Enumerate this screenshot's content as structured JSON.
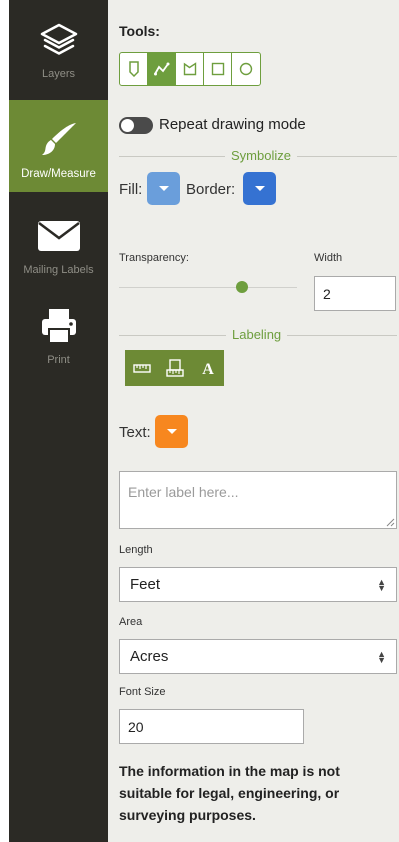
{
  "sidebar": {
    "items": [
      {
        "label": "Layers",
        "icon": "layers-icon"
      },
      {
        "label": "Draw/Measure",
        "icon": "paintbrush-icon",
        "active": true
      },
      {
        "label": "Mailing Labels",
        "icon": "envelope-icon"
      },
      {
        "label": "Print",
        "icon": "printer-icon"
      }
    ],
    "background_color": "#2b2a25",
    "active_color": "#6d8a35"
  },
  "tools": {
    "label": "Tools:",
    "buttons": [
      "marker-icon",
      "polyline-icon",
      "polygon-icon",
      "rectangle-icon",
      "circle-icon"
    ],
    "active_index": 1,
    "accent_color": "#6e9e3e"
  },
  "repeat_mode": {
    "label": "Repeat drawing mode",
    "enabled": false
  },
  "symbolize": {
    "title": "Symbolize",
    "fill_label": "Fill:",
    "fill_color": "#6a9edb",
    "border_label": "Border:",
    "border_color": "#3572d2",
    "transparency_label": "Transparency:",
    "transparency_value": 0.7,
    "width_label": "Width",
    "width_value": "2"
  },
  "labeling": {
    "title": "Labeling",
    "buttons": [
      "ruler-icon",
      "area-measure-icon",
      "text-label-icon"
    ],
    "text_label": "Text:",
    "text_color": "#f7871f",
    "label_placeholder": "Enter label here..."
  },
  "length": {
    "label": "Length",
    "value": "Feet"
  },
  "area": {
    "label": "Area",
    "value": "Acres"
  },
  "font_size": {
    "label": "Font Size",
    "value": "20"
  },
  "disclaimer": "The information in the map is not suitable for legal, engineering, or surveying purposes."
}
